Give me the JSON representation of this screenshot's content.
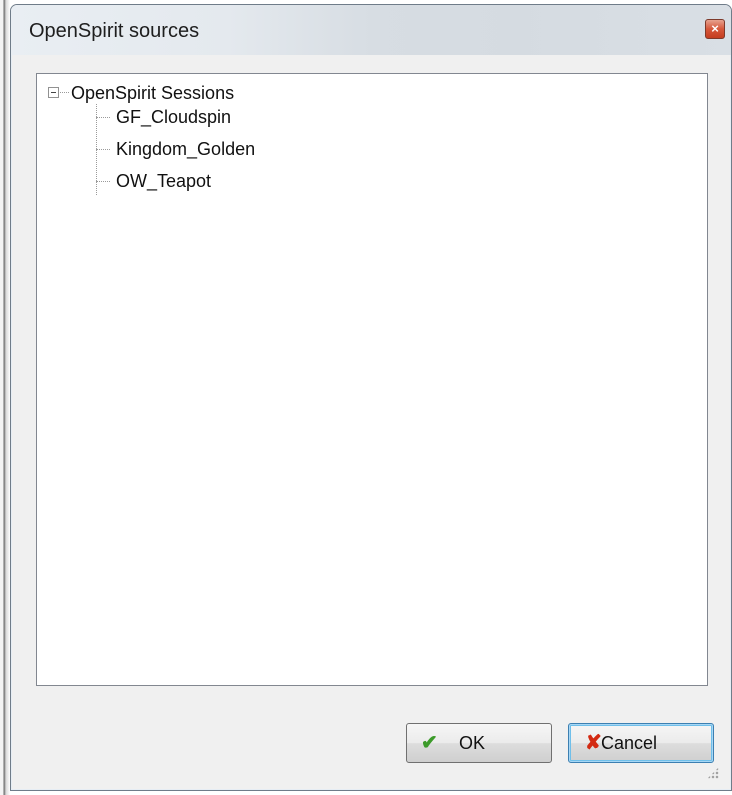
{
  "window": {
    "title": "OpenSpirit sources",
    "close_glyph": "×"
  },
  "tree": {
    "root": {
      "label": "OpenSpirit Sessions",
      "expanded": true,
      "children": [
        {
          "label": "GF_Cloudspin"
        },
        {
          "label": "Kingdom_Golden"
        },
        {
          "label": "OW_Teapot"
        }
      ]
    }
  },
  "buttons": {
    "ok_label": "OK",
    "ok_icon": "checkmark-icon",
    "cancel_label": "Cancel",
    "cancel_icon": "x-mark-icon"
  },
  "colors": {
    "ok_icon": "#3c9b2a",
    "cancel_icon": "#d32a12",
    "close_button": "#c43d1f",
    "default_button_focus": "#3c7fb1"
  }
}
